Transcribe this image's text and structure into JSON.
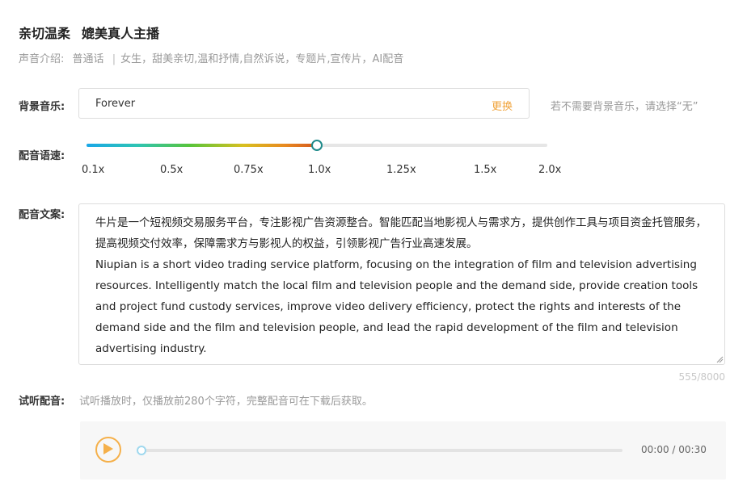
{
  "voice": {
    "name": "亲切温柔",
    "tagline": "媲美真人主播",
    "intro_label": "声音介绍:",
    "language": "普通话",
    "separator": "|",
    "description": "女生，甜美亲切,温和抒情,自然诉说，专题片,宣传片，AI配音"
  },
  "background_music": {
    "label": "背景音乐:",
    "value": "Forever",
    "change_label": "更换",
    "hint": "若不需要背景音乐，请选择“无”"
  },
  "speed": {
    "label": "配音语速:",
    "ticks": [
      "0.1x",
      "0.5x",
      "0.75x",
      "1.0x",
      "1.25x",
      "1.5x",
      "2.0x"
    ],
    "selected": "1.0x",
    "slider_fraction": 0.5
  },
  "script": {
    "label": "配音文案:",
    "paragraph_cn": "牛片是一个短视频交易服务平台，专注影视广告资源整合。智能匹配当地影视人与需求方，提供创作工具与项目资金托管服务，提高视频交付效率，保障需求方与影视人的权益，引领影视广告行业高速发展。",
    "paragraph_en": "Niupian is a short video trading service platform, focusing on the integration of film and television advertising resources. Intelligently match the local film and television people and the demand side, provide creation tools and project fund custody services, improve video delivery efficiency, protect the rights and interests of the demand side and the film and television people, and lead the rapid development of the film and television advertising industry.",
    "counter": "555/8000"
  },
  "preview": {
    "label": "试听配音:",
    "hint": "试听播放时，仅播放前280个字符，完整配音可在下载后获取。",
    "time": "00:00 / 00:30",
    "progress": 0,
    "play_icon": "play-icon"
  },
  "colors": {
    "accent": "#f0a33a",
    "slider_thumb": "#1f8a8a",
    "hint_text": "#999999"
  }
}
